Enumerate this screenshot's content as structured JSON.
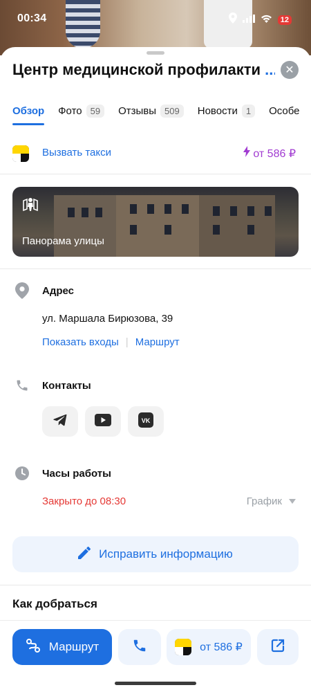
{
  "status": {
    "time": "00:34",
    "battery": "12"
  },
  "header": {
    "title": "Центр медицинской профилакти",
    "title_more": "..."
  },
  "tabs": [
    {
      "label": "Обзор",
      "count": ""
    },
    {
      "label": "Фото",
      "count": "59"
    },
    {
      "label": "Отзывы",
      "count": "509"
    },
    {
      "label": "Новости",
      "count": "1"
    },
    {
      "label": "Особе",
      "count": ""
    }
  ],
  "taxi": {
    "label": "Вызвать такси",
    "price": "от 586 ₽"
  },
  "panorama": {
    "label": "Панорама улицы"
  },
  "address": {
    "title": "Адрес",
    "value": "ул. Маршала Бирюзова, 39",
    "link_entrances": "Показать входы",
    "link_route": "Маршрут"
  },
  "contacts": {
    "title": "Контакты",
    "items": [
      "telegram-icon",
      "youtube-icon",
      "vk-icon"
    ]
  },
  "hours": {
    "title": "Часы работы",
    "status": "Закрыто до 08:30",
    "schedule": "График"
  },
  "fix_info": {
    "label": "Исправить информацию"
  },
  "how_to_get": {
    "title": "Как добраться"
  },
  "bottom": {
    "route_label": "Маршрут",
    "taxi_price": "от 586 ₽"
  },
  "colors": {
    "accent": "#1e6fe0",
    "taxi_price": "#a13bd1",
    "closed": "#e53935",
    "button_bg": "#eef4fd"
  }
}
